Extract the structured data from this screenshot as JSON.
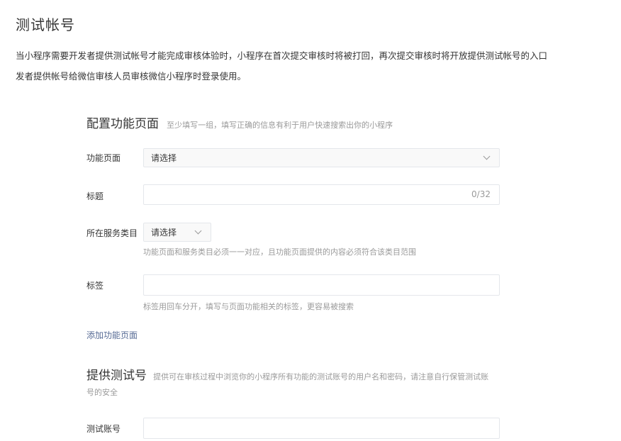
{
  "page": {
    "title": "测试帐号",
    "intro_line1": "当小程序需要开发者提供测试帐号才能完成审核体验时，小程序在首次提交审核时将被打回，再次提交审核时将开放提供测试帐号的入口",
    "intro_line2": "发者提供帐号给微信审核人员审核微信小程序时登录使用。"
  },
  "config_section": {
    "title": "配置功能页面",
    "tip": "至少填写一组，填写正确的信息有利于用户快速搜索出你的小程序",
    "function_page": {
      "label": "功能页面",
      "value": "请选择"
    },
    "title_field": {
      "label": "标题",
      "counter": "0/32"
    },
    "service_category": {
      "label": "所在服务类目",
      "value": "请选择",
      "hint": "功能页面和服务类目必须一一对应，且功能页面提供的内容必须符合该类目范围"
    },
    "tags": {
      "label": "标签",
      "hint": "标签用回车分开，填写与页面功能相关的标签，更容易被搜索"
    },
    "add_link": "添加功能页面"
  },
  "test_account_section": {
    "title": "提供测试号",
    "tip_line1": "提供可在审核过程中浏览你的小程序所有功能的测试账号的用户名和密码，请注意自行保管测试账",
    "tip_line2": "号的安全",
    "account_field": {
      "label": "测试账号"
    }
  },
  "icons": {
    "function_page_dropdown": "chevron-down-icon",
    "service_category_dropdown": "chevron-down-icon"
  }
}
